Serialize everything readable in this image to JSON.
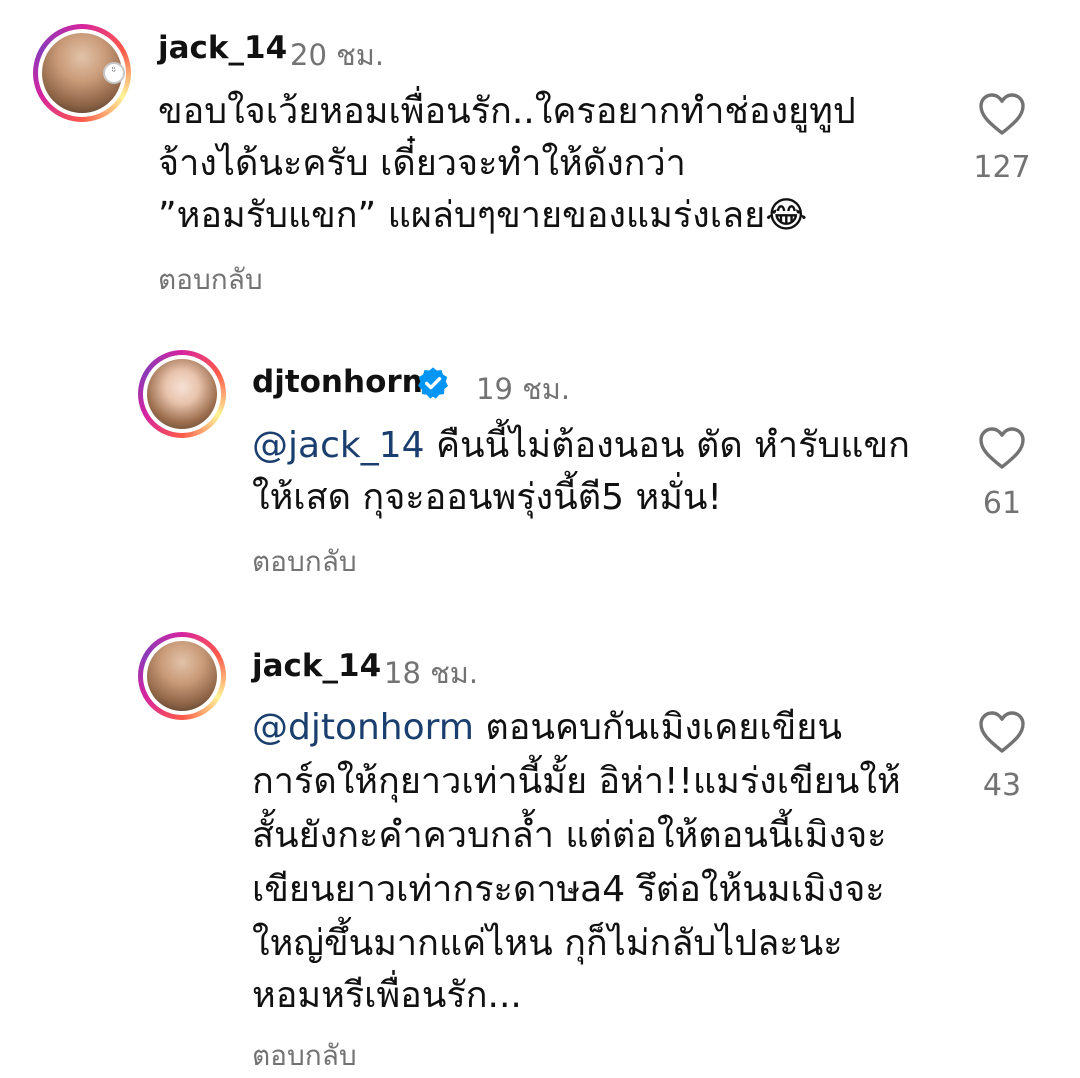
{
  "comments": [
    {
      "username": "jack_14",
      "time": "20 ชม.",
      "lines": [
        "ขอบใจเว้ยหอมเพื่อนรัก..ใครอยากทำช่องยูทูป",
        "จ้างได้นะครับ เดี๋ยวจะทำให้ดังกว่า",
        "”หอมรับแขก” แผล่บๆขายของแมร่งเลย😂"
      ],
      "reply_label": "ตอบกลับ",
      "likes": "127"
    },
    {
      "username": "djtonhorm",
      "time": "19 ชม.",
      "mention": "@jack_14",
      "lines": [
        " คืนนี้ไม่ต้องนอน ตัด หำรับแขก",
        "ให้เสด กุจะออนพรุ่งนี้ตี5 หมั่น!"
      ],
      "reply_label": "ตอบกลับ",
      "likes": "61"
    },
    {
      "username": "jack_14",
      "time": "18 ชม.",
      "mention": "@djtonhorm",
      "lines": [
        " ตอนคบกันเมิงเคยเขียน",
        "การ์ดให้กุยาวเท่านี้มั้ย อิห่า!!แมร่งเขียนให้",
        "สั้นยังกะคำควบกล้ำ แต่ต่อให้ตอนนี้เมิงจะ",
        "เขียนยาวเท่ากระดาษa4 รึต่อให้นมเมิงจะ",
        "ใหญ่ขึ้นมากแค่ไหน กุก็ไม่กลับไปละนะ",
        "หอมหรีเพื่อนรัก..."
      ],
      "reply_label": "ตอบกลับ",
      "likes": "43"
    }
  ],
  "icons": {
    "like": "heart-icon",
    "verified": "verified-badge-icon"
  },
  "colors": {
    "mention": "#1a3e6e",
    "verified": "#0095f6",
    "muted": "#737373"
  }
}
